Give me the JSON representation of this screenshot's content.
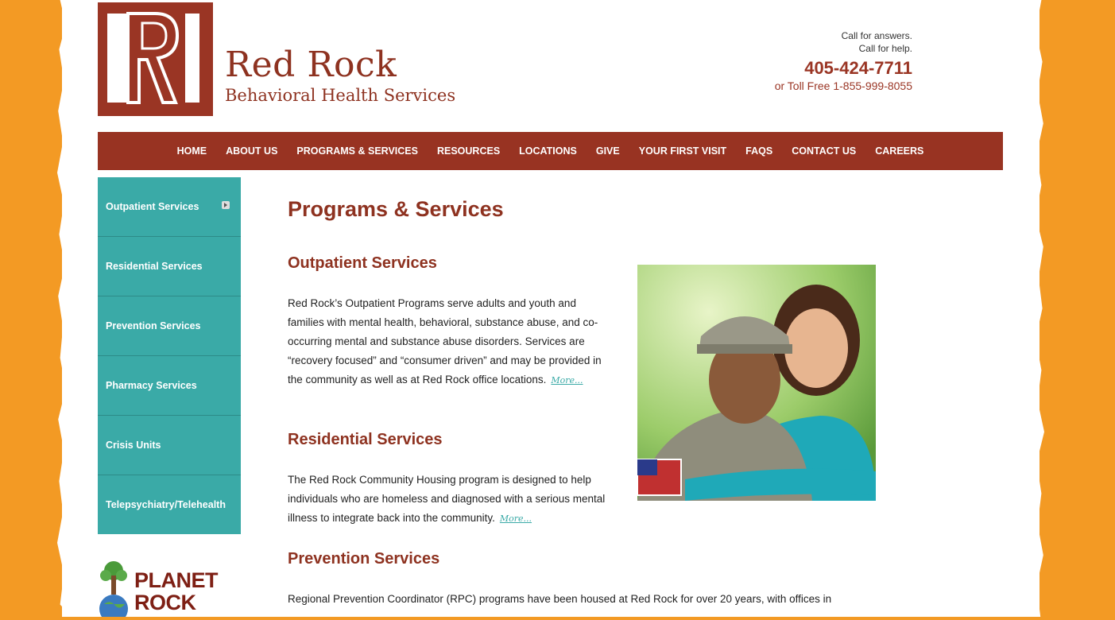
{
  "brand": {
    "name": "Red Rock",
    "subtitle": "Behavioral Health Services",
    "logo_color": "#9a3524"
  },
  "contact": {
    "line1": "Call for answers.",
    "line2": "Call for help.",
    "phone": "405-424-7711",
    "toll_free": "or Toll Free 1-855-999-8055"
  },
  "nav": {
    "items": [
      "HOME",
      "ABOUT US",
      "PROGRAMS & SERVICES",
      "RESOURCES",
      "LOCATIONS",
      "GIVE",
      "YOUR FIRST VISIT",
      "FAQS",
      "CONTACT US",
      "CAREERS"
    ]
  },
  "sidebar": {
    "items": [
      {
        "label": "Outpatient Services"
      },
      {
        "label": "Residential Services"
      },
      {
        "label": "Prevention Services"
      },
      {
        "label": "Pharmacy Services"
      },
      {
        "label": "Crisis Units"
      },
      {
        "label": "Telepsychiatry/Telehealth"
      }
    ]
  },
  "planet_rock": {
    "line1": "PLANET",
    "line2": "ROCK"
  },
  "main": {
    "title": "Programs & Services",
    "sections": [
      {
        "title": "Outpatient Services",
        "text": "Red Rock’s Outpatient Programs serve adults and youth and families with mental health, behavioral, substance abuse, and co-occurring mental and substance abuse disorders. Services are “recovery focused” and “consumer driven” and may be provided in the community as well as at Red Rock office locations.",
        "more": "More..."
      },
      {
        "title": "Residential Services",
        "text": "The Red Rock Community Housing program is designed to help individuals who are homeless and diagnosed with a serious mental illness to integrate back into the community.",
        "more": "More..."
      },
      {
        "title": "Prevention Services",
        "text": "Regional Prevention Coordinator (RPC) programs have been housed at Red Rock for over 20 years, with offices in"
      }
    ]
  },
  "colors": {
    "background_orange": "#f39a24",
    "nav_red": "#983322",
    "sidebar_teal": "#3aaaa7",
    "heading_red": "#8e3220"
  }
}
